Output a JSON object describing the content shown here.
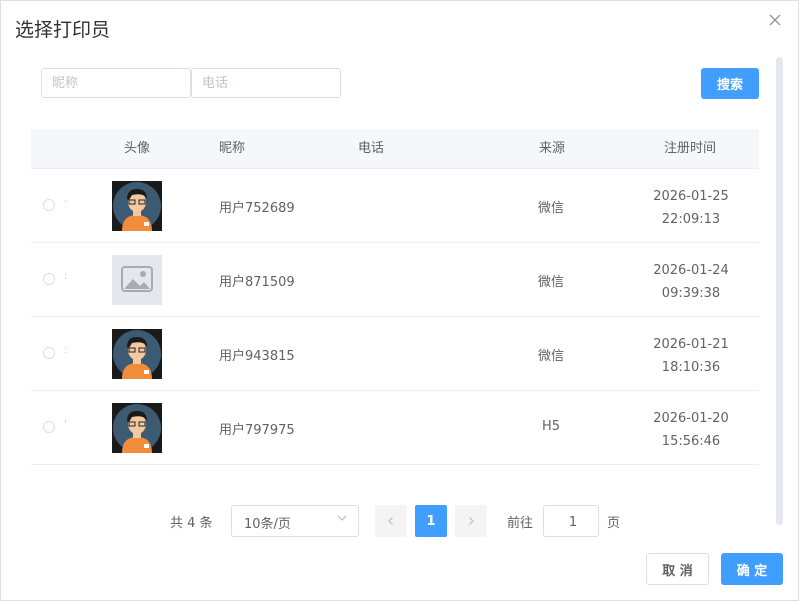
{
  "dialog": {
    "title": "选择打印员",
    "close_icon": "close-icon"
  },
  "search": {
    "nickname_placeholder": "昵称",
    "phone_placeholder": "电话",
    "search_button": "搜索"
  },
  "table": {
    "headers": {
      "avatar": "头像",
      "nickname": "昵称",
      "phone": "电话",
      "source": "来源",
      "registered": "注册时间"
    },
    "rows": [
      {
        "avatar": "user-avatar",
        "nickname": "用户752689",
        "phone": "",
        "source": "微信",
        "date": "2026-01-25",
        "time": "22:09:13"
      },
      {
        "avatar": "image-placeholder-icon",
        "nickname": "用户871509",
        "phone": "",
        "source": "微信",
        "date": "2026-01-24",
        "time": "09:39:38"
      },
      {
        "avatar": "user-avatar",
        "nickname": "用户943815",
        "phone": "",
        "source": "微信",
        "date": "2026-01-21",
        "time": "18:10:36"
      },
      {
        "avatar": "user-avatar",
        "nickname": "用户797975",
        "phone": "",
        "source": "H5",
        "date": "2026-01-20",
        "time": "15:56:46"
      }
    ]
  },
  "pagination": {
    "total": "共 4 条",
    "page_size": "10条/页",
    "prev_icon": "chevron-left-icon",
    "next_icon": "chevron-right-icon",
    "current_page": "1",
    "goto_label": "前往",
    "goto_value": "1",
    "goto_suffix": "页"
  },
  "footer": {
    "cancel": "取 消",
    "confirm": "确 定"
  },
  "colors": {
    "primary": "#409eff",
    "border": "#dcdfe6",
    "header_bg": "#f5f7fa"
  }
}
